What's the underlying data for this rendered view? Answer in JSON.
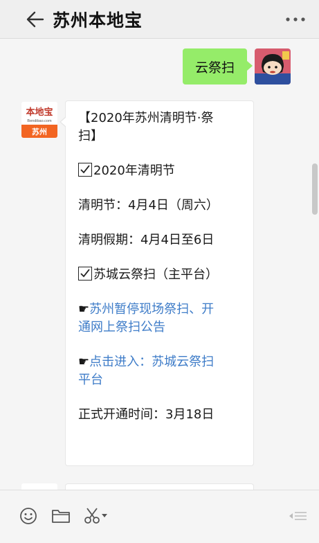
{
  "header": {
    "title": "苏州本地宝"
  },
  "chat": {
    "outgoing": {
      "text": "云祭扫"
    },
    "bot": {
      "logo_top": "本地宝",
      "logo_url": "Bendibao.com",
      "logo_city": "苏州"
    },
    "incoming": {
      "line1a": "【2020年苏州清明节·祭",
      "line1b": "扫】",
      "line2": "2020年清明节",
      "line3": "清明节：4月4日（周六）",
      "line4": "清明假期：4月4日至6日",
      "line5": "苏城云祭扫（主平台）",
      "pointer": "☛",
      "link1a": "苏州暂停现场祭扫、开",
      "link1b": "通网上祭扫公告",
      "link2a": "点击进入：苏城云祭扫",
      "link2b": "平台",
      "line6": "正式开通时间：3月18日"
    }
  },
  "icons": [
    "back-arrow-icon",
    "more-icon",
    "emoji-icon",
    "folder-icon",
    "scissors-icon",
    "dropdown-arrow-icon",
    "chat-list-icon"
  ],
  "colors": {
    "outgoing_bubble": "#95ec69",
    "link": "#3e7cc8",
    "brand_orange": "#f26522"
  }
}
